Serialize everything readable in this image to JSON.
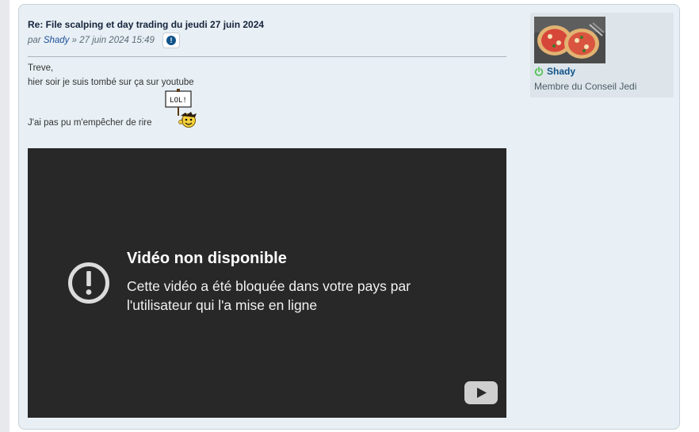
{
  "post": {
    "title": "Re: File scalping et day trading du jeudi 27 juin 2024",
    "meta_prefix": "par ",
    "author": "Shady",
    "meta_suffix": " » 27 juin 2024 15:49",
    "report_icon": "exclamation-circle-icon",
    "body_lines": [
      "Treve,",
      "hier soir je suis tombé sur ça sur youtube",
      "J'ai pas pu m'empêcher de rire"
    ],
    "smiley_sign_text": "LOL!"
  },
  "video": {
    "title": "Vidéo non disponible",
    "message": "Cette vidéo a été bloquée dans votre pays par l'utilisateur qui l'a mise en ligne",
    "logo": "youtube-logo"
  },
  "profile": {
    "username": "Shady",
    "rank": "Membre du Conseil Jedi",
    "status_icon": "online-icon"
  },
  "colors": {
    "post_bg": "#e8f0f5",
    "profile_bg": "#dde5ea",
    "link": "#105289",
    "video_bg": "#282828",
    "online": "#4fc14f"
  }
}
